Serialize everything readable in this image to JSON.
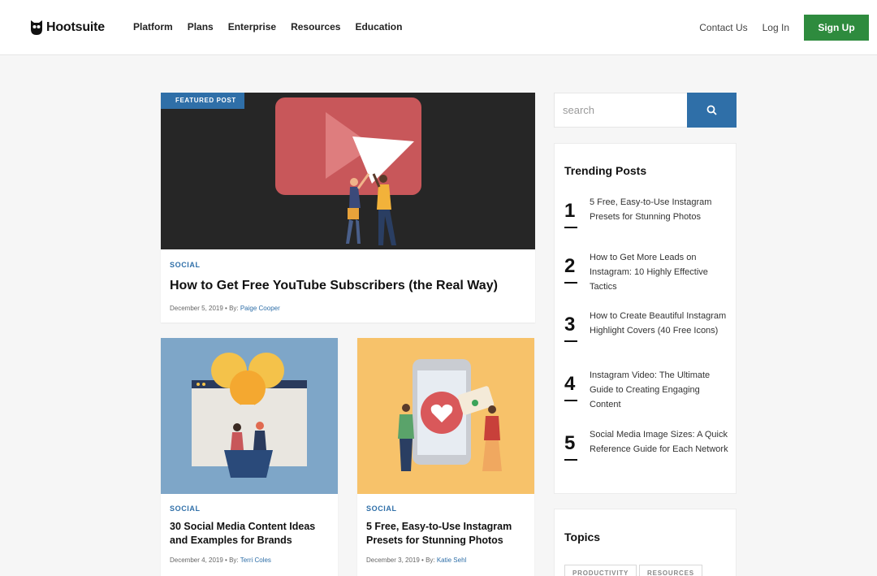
{
  "header": {
    "logo_text": "Hootsuite",
    "nav": [
      "Platform",
      "Plans",
      "Enterprise",
      "Resources",
      "Education"
    ],
    "contact": "Contact Us",
    "login": "Log In",
    "signup": "Sign Up"
  },
  "featured": {
    "badge": "FEATURED POST",
    "category": "SOCIAL",
    "title": "How to Get Free YouTube Subscribers (the Real Way)",
    "date_prefix": "December 5, 2019 • By: ",
    "author": "Paige Cooper"
  },
  "posts": [
    {
      "category": "SOCIAL",
      "title": "30 Social Media Content Ideas and Examples for Brands",
      "date_prefix": "December 4, 2019 • By: ",
      "author": "Terri Coles"
    },
    {
      "category": "SOCIAL",
      "title": "5 Free, Easy-to-Use Instagram Presets for Stunning Photos",
      "date_prefix": "December 3, 2019 • By: ",
      "author": "Katie Sehl"
    }
  ],
  "search": {
    "placeholder": "search"
  },
  "trending": {
    "heading": "Trending Posts",
    "items": [
      {
        "num": "1",
        "title": "5 Free, Easy-to-Use Instagram Presets for Stunning Photos"
      },
      {
        "num": "2",
        "title": "How to Get More Leads on Instagram: 10 Highly Effective Tactics"
      },
      {
        "num": "3",
        "title": "How to Create Beautiful Instagram Highlight Covers (40 Free Icons)"
      },
      {
        "num": "4",
        "title": "Instagram Video: The Ultimate Guide to Creating Engaging Content"
      },
      {
        "num": "5",
        "title": "Social Media Image Sizes: A Quick Reference Guide for Each Network"
      }
    ]
  },
  "topics": {
    "heading": "Topics",
    "tags": [
      "PRODUCTIVITY",
      "RESOURCES"
    ]
  },
  "colors": {
    "accent_blue": "#2f6fa8",
    "signup_green": "#2e8b3e"
  }
}
